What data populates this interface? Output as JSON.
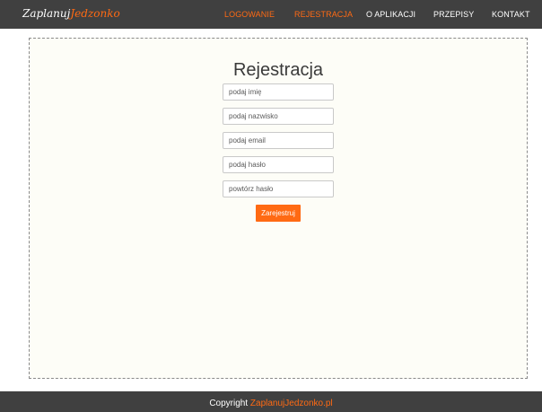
{
  "header": {
    "logo": {
      "part1": "Zaplanuj",
      "part2": "Jedzonko"
    },
    "nav": [
      {
        "label": "LOGOWANIE",
        "active": true
      },
      {
        "label": "REJESTRACJA",
        "active": true
      },
      {
        "label": "O APLIKACJI",
        "active": false
      },
      {
        "label": "PRZEPISY",
        "active": false
      },
      {
        "label": "KONTAKT",
        "active": false
      }
    ]
  },
  "form": {
    "title": "Rejestracja",
    "fields": [
      {
        "placeholder": "podaj imię",
        "value": ""
      },
      {
        "placeholder": "podaj nazwisko",
        "value": ""
      },
      {
        "placeholder": "podaj email",
        "value": ""
      },
      {
        "placeholder": "podaj hasło",
        "value": ""
      },
      {
        "placeholder": "powtórz hasło",
        "value": ""
      }
    ],
    "submit_label": "Zarejestruj"
  },
  "footer": {
    "copyright_label": "Copyright",
    "site": "ZaplanujJedzonko.pl"
  },
  "colors": {
    "accent": "#ff6a13",
    "bar_background": "#404040",
    "panel_background": "#fdfdf7"
  }
}
